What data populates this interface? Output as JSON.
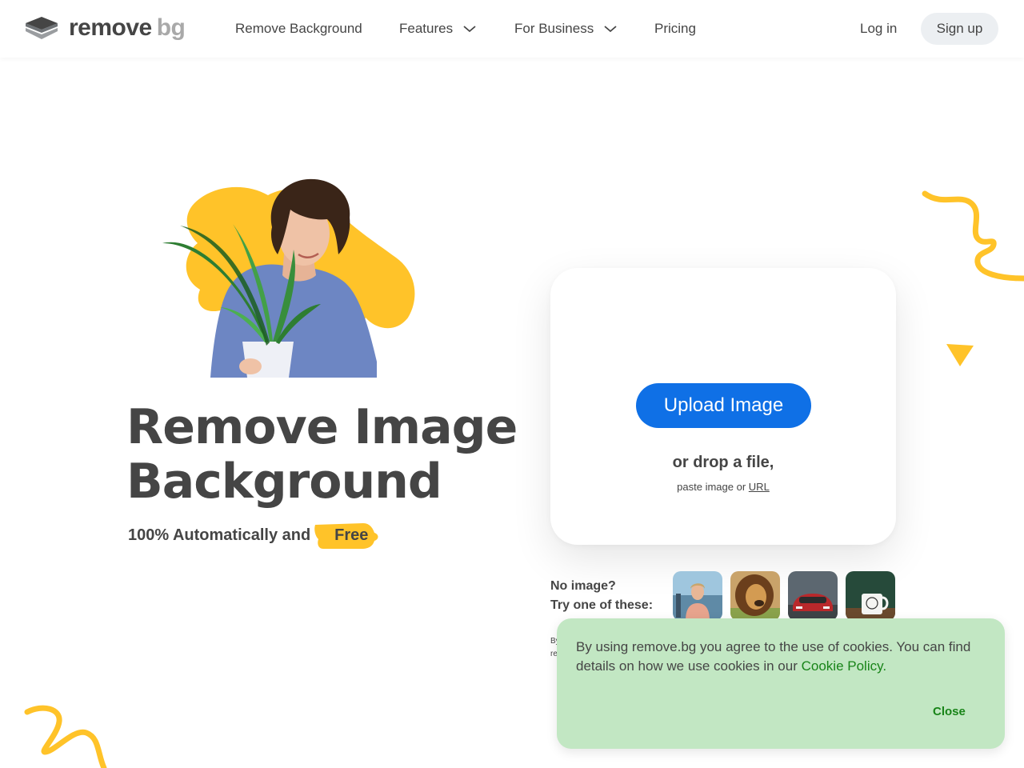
{
  "header": {
    "logo": {
      "word1": "remove",
      "word2": "bg"
    },
    "nav": [
      {
        "label": "Remove Background",
        "has_chevron": false
      },
      {
        "label": "Features",
        "has_chevron": true
      },
      {
        "label": "For Business",
        "has_chevron": true
      },
      {
        "label": "Pricing",
        "has_chevron": false
      }
    ],
    "login_label": "Log in",
    "signup_label": "Sign up"
  },
  "hero": {
    "title_line1": "Remove Image",
    "title_line2": "Background",
    "subtitle": "100% Automatically and",
    "free_badge": "Free"
  },
  "upload": {
    "button_label": "Upload Image",
    "drop_text": "or drop a file,",
    "paste_text": "paste image or",
    "url_label": "URL"
  },
  "samples": {
    "line1": "No image?",
    "line2": "Try one of these:",
    "thumbnails": [
      "person-thumbnail",
      "lion-thumbnail",
      "car-thumbnail",
      "mug-thumbnail"
    ]
  },
  "disclaimer": {
    "line1": "By",
    "line2": "re"
  },
  "cookie": {
    "text": "By using remove.bg you agree to the use of cookies. You can find details on how we use cookies in our",
    "link_label": "Cookie Policy",
    "after_link": ".",
    "close_label": "Close"
  },
  "colors": {
    "primary_blue": "#0f70e6",
    "accent_yellow": "#ffc329",
    "text_dark": "#454545",
    "cookie_bg": "#c2e7c3",
    "cookie_link": "#188418"
  }
}
